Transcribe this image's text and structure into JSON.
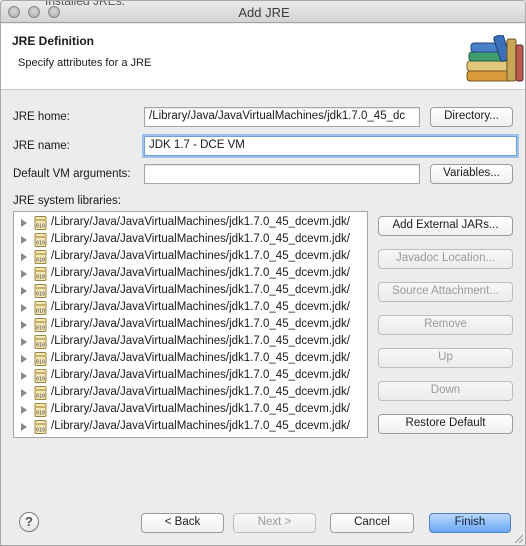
{
  "window": {
    "title": "Add JRE",
    "ghost_text": "Installed JREs:"
  },
  "header": {
    "title": "JRE Definition",
    "subtitle": "Specify attributes for a JRE",
    "icon": "books-icon"
  },
  "form": {
    "jre_home_label": "JRE home:",
    "jre_home_value": "/Library/Java/JavaVirtualMachines/jdk1.7.0_45_dc",
    "directory_button": "Directory...",
    "jre_name_label": "JRE name:",
    "jre_name_value": "JDK 1.7 - DCE VM",
    "vm_args_label": "Default VM arguments:",
    "vm_args_value": "",
    "variables_button": "Variables..."
  },
  "libraries": {
    "label": "JRE system libraries:",
    "items": [
      "/Library/Java/JavaVirtualMachines/jdk1.7.0_45_dcevm.jdk/",
      "/Library/Java/JavaVirtualMachines/jdk1.7.0_45_dcevm.jdk/",
      "/Library/Java/JavaVirtualMachines/jdk1.7.0_45_dcevm.jdk/",
      "/Library/Java/JavaVirtualMachines/jdk1.7.0_45_dcevm.jdk/",
      "/Library/Java/JavaVirtualMachines/jdk1.7.0_45_dcevm.jdk/",
      "/Library/Java/JavaVirtualMachines/jdk1.7.0_45_dcevm.jdk/",
      "/Library/Java/JavaVirtualMachines/jdk1.7.0_45_dcevm.jdk/",
      "/Library/Java/JavaVirtualMachines/jdk1.7.0_45_dcevm.jdk/",
      "/Library/Java/JavaVirtualMachines/jdk1.7.0_45_dcevm.jdk/",
      "/Library/Java/JavaVirtualMachines/jdk1.7.0_45_dcevm.jdk/",
      "/Library/Java/JavaVirtualMachines/jdk1.7.0_45_dcevm.jdk/",
      "/Library/Java/JavaVirtualMachines/jdk1.7.0_45_dcevm.jdk/",
      "/Library/Java/JavaVirtualMachines/jdk1.7.0_45_dcevm.jdk/"
    ],
    "buttons": {
      "add_external_jars": "Add External JARs...",
      "javadoc_location": "Javadoc Location...",
      "source_attachment": "Source Attachment...",
      "remove": "Remove",
      "up": "Up",
      "down": "Down",
      "restore_default": "Restore Default"
    }
  },
  "footer": {
    "help": "?",
    "back": "< Back",
    "next": "Next >",
    "cancel": "Cancel",
    "finish": "Finish"
  }
}
